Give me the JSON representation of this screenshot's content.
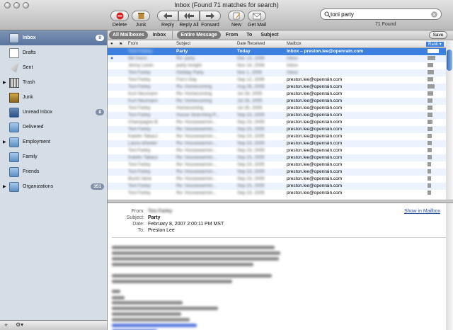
{
  "window": {
    "title": "Inbox (Found 71 matches for search)"
  },
  "toolbar": {
    "delete": "Delete",
    "junk": "Junk",
    "reply": "Reply",
    "reply_all": "Reply All",
    "forward": "Forward",
    "new": "New",
    "get_mail": "Get Mail"
  },
  "search": {
    "value": "toni party",
    "found": "71 Found"
  },
  "sidebar": [
    {
      "label": "Inbox",
      "badge": "8",
      "icon": "inbox-icon",
      "selected": true,
      "disclosure": false
    },
    {
      "label": "Drafts",
      "badge": "",
      "icon": "drafts-icon",
      "selected": false,
      "disclosure": false
    },
    {
      "label": "Sent",
      "badge": "",
      "icon": "sent-icon",
      "selected": false,
      "disclosure": false
    },
    {
      "label": "Trash",
      "badge": "",
      "icon": "trash-icon",
      "selected": false,
      "disclosure": true
    },
    {
      "label": "Junk",
      "badge": "",
      "icon": "junk-icon",
      "selected": false,
      "disclosure": false
    },
    {
      "label": "Unread Inbox",
      "badge": "8",
      "icon": "smart-mailbox-icon",
      "selected": false,
      "disclosure": false
    },
    {
      "label": "Delivered",
      "badge": "",
      "icon": "folder-icon",
      "selected": false,
      "disclosure": false
    },
    {
      "label": "Employment",
      "badge": "",
      "icon": "folder-icon",
      "selected": false,
      "disclosure": true
    },
    {
      "label": "Family",
      "badge": "",
      "icon": "folder-icon",
      "selected": false,
      "disclosure": false
    },
    {
      "label": "Friends",
      "badge": "",
      "icon": "folder-icon",
      "selected": false,
      "disclosure": false
    },
    {
      "label": "Organizations",
      "badge": "351",
      "icon": "folder-icon",
      "selected": false,
      "disclosure": true
    }
  ],
  "scope": {
    "all_mailboxes": "All Mailboxes",
    "inbox": "Inbox",
    "entire_message": "Entire Message",
    "from": "From",
    "to": "To",
    "subject": "Subject",
    "save": "Save"
  },
  "columns": {
    "from": "From",
    "subject": "Subject",
    "date": "Date Received",
    "mailbox": "Mailbox",
    "rank": "Rank"
  },
  "messages": [
    {
      "from": "Toni Farley",
      "subject": "Party",
      "date": "Today",
      "mailbox": "Inbox – preston.lee@openrain.com",
      "rank": 0.9,
      "unread": false,
      "selected": true
    },
    {
      "from": "Bill Davis",
      "subject": "Re: party",
      "date": "Dec 13, 2006",
      "mailbox": "Inbox",
      "rank": 0.6,
      "unread": true,
      "selected": false
    },
    {
      "from": "Jenny Lewis",
      "subject": "party tonight",
      "date": "Nov 14, 2006",
      "mailbox": "Inbox",
      "rank": 0.45,
      "unread": false,
      "selected": false
    },
    {
      "from": "Toni Farley",
      "subject": "Holiday Party",
      "date": "Nov 1, 2006",
      "mailbox": "Inbox",
      "rank": 0.5,
      "unread": false,
      "selected": false
    },
    {
      "from": "Toni Farley",
      "subject": "Foo's Day",
      "date": "Sep 12, 2006",
      "mailbox": "preston.lee@openrain.com",
      "rank": 0.45,
      "unread": false,
      "selected": false
    },
    {
      "from": "Toni Farley",
      "subject": "Re: Homecoming",
      "date": "Aug 26, 2005",
      "mailbox": "preston.lee@openrain.com",
      "rank": 0.55,
      "unread": false,
      "selected": false
    },
    {
      "from": "Kurt Neumann",
      "subject": "Re: Homecoming",
      "date": "Jul 28, 2005",
      "mailbox": "preston.lee@openrain.com",
      "rank": 0.45,
      "unread": false,
      "selected": false
    },
    {
      "from": "Kurt Neumann",
      "subject": "Re: Homecoming",
      "date": "Jul 26, 2005",
      "mailbox": "preston.lee@openrain.com",
      "rank": 0.4,
      "unread": false,
      "selected": false
    },
    {
      "from": "Toni Farley",
      "subject": "Homecoming",
      "date": "Jul 26, 2005",
      "mailbox": "preston.lee@openrain.com",
      "rank": 0.4,
      "unread": false,
      "selected": false
    },
    {
      "from": "Toni Farley",
      "subject": "House Searching P...",
      "date": "Sep 23, 2005",
      "mailbox": "preston.lee@openrain.com",
      "rank": 0.4,
      "unread": false,
      "selected": false
    },
    {
      "from": "Champagne B.",
      "subject": "Re: Housewarmin...",
      "date": "Sep 23, 2005",
      "mailbox": "preston.lee@openrain.com",
      "rank": 0.4,
      "unread": false,
      "selected": false
    },
    {
      "from": "Toni Farley",
      "subject": "Re: Housewarmin...",
      "date": "Sep 23, 2005",
      "mailbox": "preston.lee@openrain.com",
      "rank": 0.4,
      "unread": false,
      "selected": false
    },
    {
      "from": "Katelin Tabacz",
      "subject": "Re: Housewarmin...",
      "date": "Sep 23, 2005",
      "mailbox": "preston.lee@openrain.com",
      "rank": 0.35,
      "unread": false,
      "selected": false
    },
    {
      "from": "Laura wheeler",
      "subject": "Re: Housewarmin...",
      "date": "Sep 23, 2005",
      "mailbox": "preston.lee@openrain.com",
      "rank": 0.35,
      "unread": false,
      "selected": false
    },
    {
      "from": "Toni Farley",
      "subject": "Re: Housewarmin...",
      "date": "Sep 23, 2005",
      "mailbox": "preston.lee@openrain.com",
      "rank": 0.35,
      "unread": false,
      "selected": false
    },
    {
      "from": "Katelin Tabacz",
      "subject": "Re: Housewarmin...",
      "date": "Sep 23, 2005",
      "mailbox": "preston.lee@openrain.com",
      "rank": 0.35,
      "unread": false,
      "selected": false
    },
    {
      "from": "Toni Farley",
      "subject": "Re: Housewarmin...",
      "date": "Sep 23, 2005",
      "mailbox": "preston.lee@openrain.com",
      "rank": 0.3,
      "unread": false,
      "selected": false
    },
    {
      "from": "Toni Farley",
      "subject": "Re: Housewarmin...",
      "date": "Sep 23, 2005",
      "mailbox": "preston.lee@openrain.com",
      "rank": 0.3,
      "unread": false,
      "selected": false
    },
    {
      "from": "Buchi Varia",
      "subject": "Re: Housewarmin...",
      "date": "Sep 23, 2005",
      "mailbox": "preston.lee@openrain.com",
      "rank": 0.3,
      "unread": false,
      "selected": false
    },
    {
      "from": "Toni Farley",
      "subject": "Re: Housewarmin...",
      "date": "Sep 23, 2005",
      "mailbox": "preston.lee@openrain.com",
      "rank": 0.3,
      "unread": false,
      "selected": false
    },
    {
      "from": "Toni Farley",
      "subject": "Re: Housewarmin...",
      "date": "Sep 23, 2005",
      "mailbox": "preston.lee@openrain.com",
      "rank": 0.3,
      "unread": false,
      "selected": false
    }
  ],
  "preview": {
    "labels": {
      "from": "From:",
      "subject": "Subject:",
      "date": "Date:",
      "to": "To:"
    },
    "from": "Toni Farley",
    "subject": "Party",
    "date": "February 8, 2007 2:00:11 PM MST",
    "to": "Preston Lee",
    "show_in_mailbox": "Show in Mailbox"
  }
}
